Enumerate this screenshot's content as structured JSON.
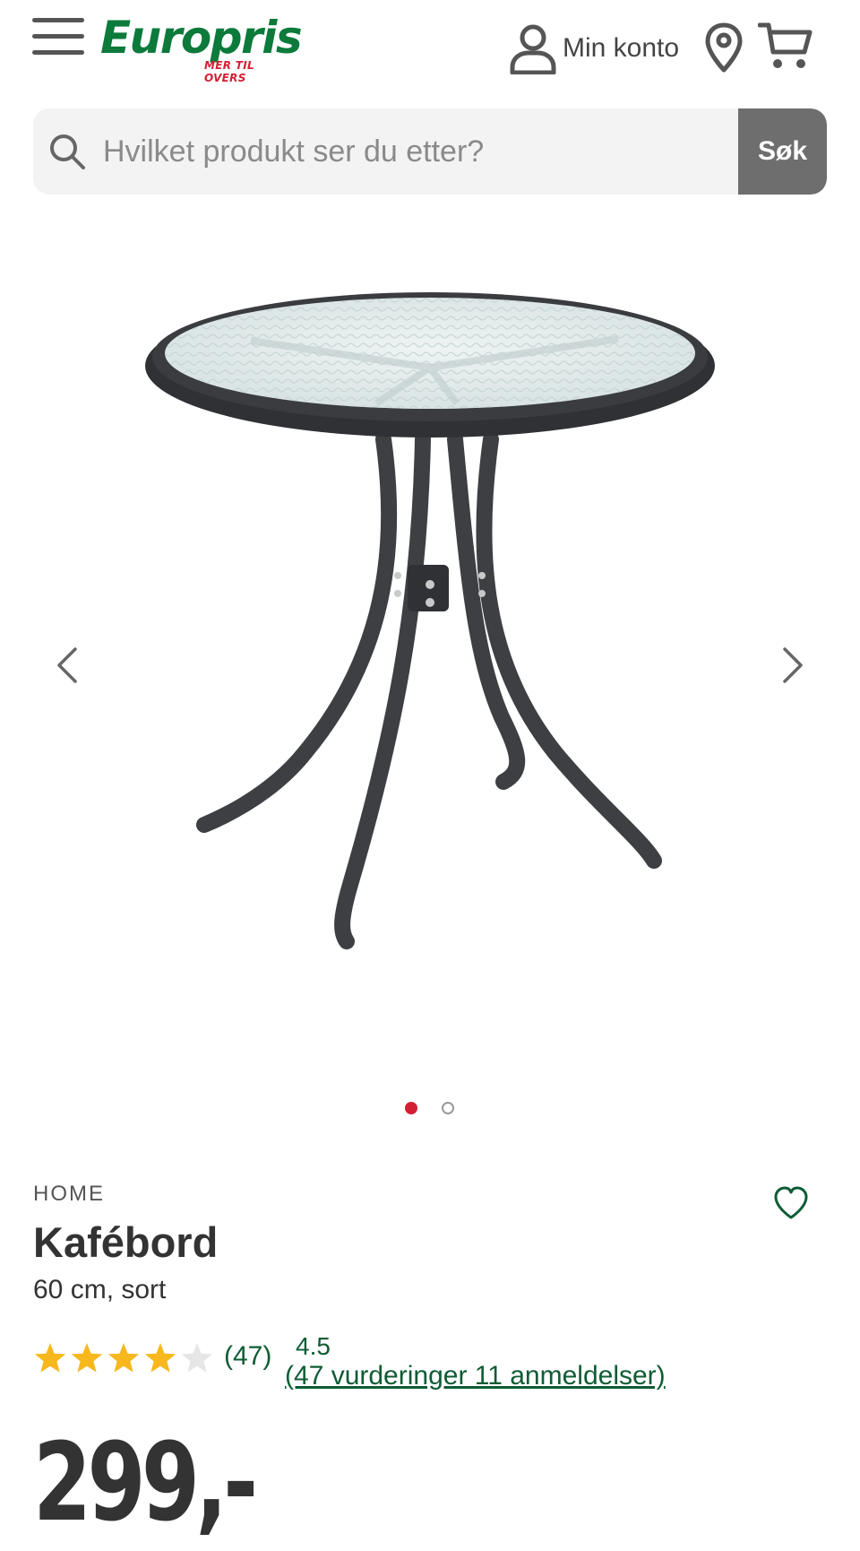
{
  "header": {
    "logo_text": "Europris",
    "logo_tagline": "MER TIL OVERS",
    "account_label": "Min konto",
    "menu_icon": "hamburger-menu-icon",
    "account_icon": "user-icon",
    "location_icon": "map-pin-icon",
    "cart_icon": "cart-icon"
  },
  "search": {
    "placeholder": "Hvilket produkt ser du etter?",
    "button_label": "Søk"
  },
  "gallery": {
    "image_count": 2,
    "active_index": 0,
    "prev_icon": "chevron-left-icon",
    "next_icon": "chevron-right-icon"
  },
  "product": {
    "brand": "HOME",
    "title": "Kafébord",
    "subtitle": "60 cm, sort",
    "rating_count": "(47)",
    "rating_value": "4.5",
    "rating_link": "(47 vurderinger 11 anmeldelser)",
    "stars_filled": 4.5,
    "stars_max": 5,
    "price": "299,-"
  },
  "colors": {
    "brand_green": "#0b7a3b",
    "brand_red": "#d31f34",
    "link_green": "#0f5c34",
    "star_yellow": "#f6b81c",
    "active_dot": "#d31f34"
  }
}
